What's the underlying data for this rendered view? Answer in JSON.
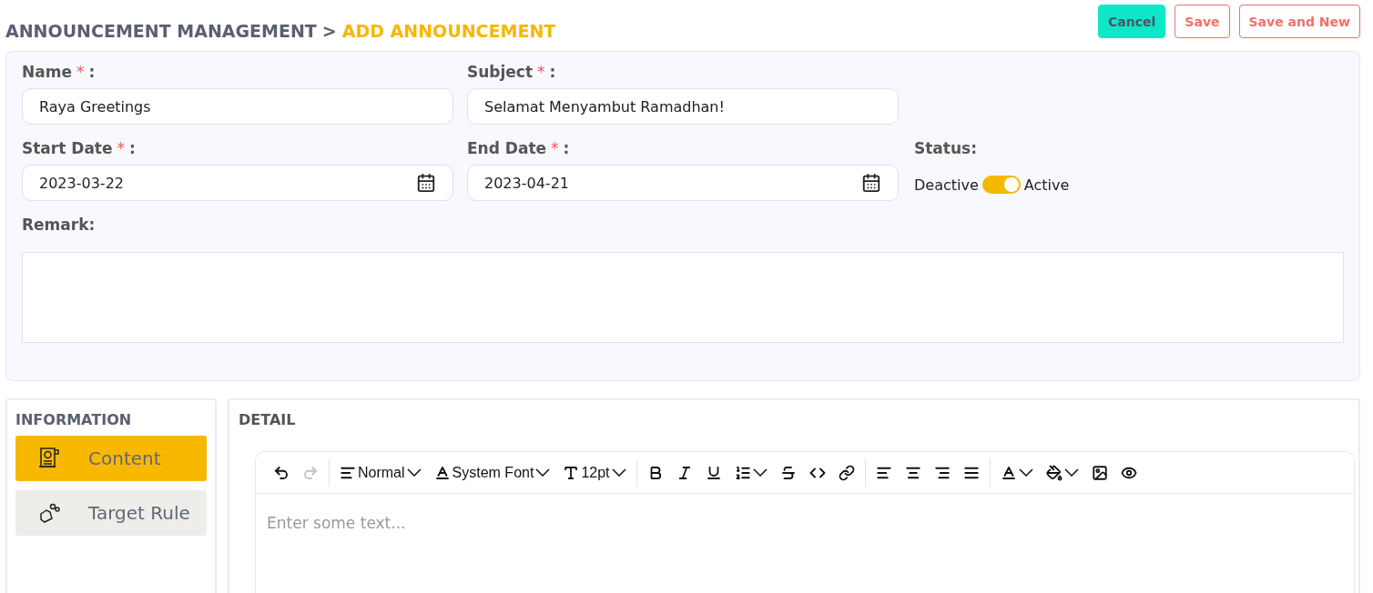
{
  "breadcrumb": {
    "parent": "ANNOUNCEMENT MANAGEMENT",
    "separator": ">",
    "current": "ADD ANNOUNCEMENT"
  },
  "actions": [
    {
      "label": "Cancel",
      "kind": "primary"
    },
    {
      "label": "Save",
      "kind": "outline"
    },
    {
      "label": "Save and New",
      "kind": "outline"
    }
  ],
  "form": {
    "name": {
      "label": "Name",
      "required_mark": "*",
      "suffix": ":",
      "value": "Raya Greetings"
    },
    "subject": {
      "label": "Subject",
      "required_mark": "*",
      "suffix": ":",
      "value": "Selamat Menyambut Ramadhan!"
    },
    "start_date": {
      "label": "Start Date",
      "required_mark": "*",
      "suffix": ":",
      "value": "2023-03-22"
    },
    "end_date": {
      "label": "End Date",
      "required_mark": "*",
      "suffix": ":",
      "value": "2023-04-21"
    },
    "status": {
      "label": "Status:",
      "off_label": "Deactive",
      "on_label": "Active",
      "on": true
    },
    "remark": {
      "label": "Remark:"
    }
  },
  "sidebar": {
    "title": "INFORMATION",
    "items": [
      {
        "label": "Content",
        "kind": "scroll",
        "selected": true
      },
      {
        "label": "Target Rule",
        "kind": "hand",
        "selected": false
      }
    ]
  },
  "detail": {
    "title": "DETAIL",
    "placeholder": "Enter some text...",
    "toolbar": [
      [
        {
          "kind": "undo",
          "disabled": false
        },
        {
          "kind": "redo",
          "disabled": true
        }
      ],
      [
        {
          "kind": "paragraph",
          "label": "Normal"
        },
        {
          "kind": "font",
          "label": "System Font"
        },
        {
          "kind": "size",
          "label": "12pt"
        }
      ],
      [
        {
          "kind": "bold"
        },
        {
          "kind": "italic"
        },
        {
          "kind": "underline"
        },
        {
          "kind": "lineheight",
          "dropdown": true
        },
        {
          "kind": "strike"
        },
        {
          "kind": "code"
        },
        {
          "kind": "link"
        }
      ],
      [
        {
          "kind": "left"
        },
        {
          "kind": "center"
        },
        {
          "kind": "right"
        },
        {
          "kind": "justify"
        }
      ],
      [
        {
          "kind": "color",
          "dropdown": true
        },
        {
          "kind": "fill",
          "dropdown": true
        },
        {
          "kind": "image"
        },
        {
          "kind": "preview"
        }
      ]
    ]
  }
}
